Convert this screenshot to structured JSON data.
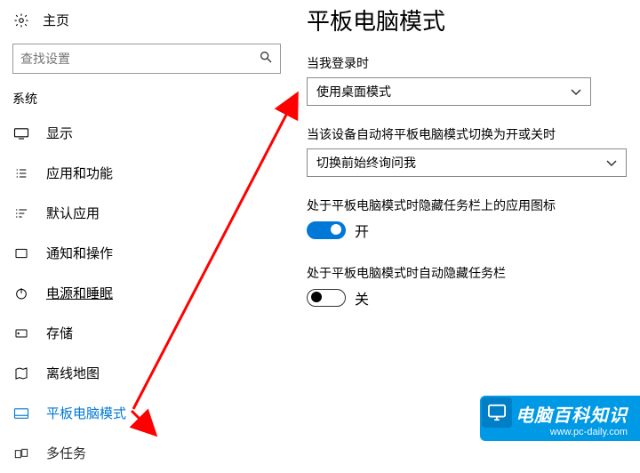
{
  "sidebar": {
    "home_label": "主页",
    "search_placeholder": "查找设置",
    "group_label": "系统",
    "items": [
      {
        "label": "显示"
      },
      {
        "label": "应用和功能"
      },
      {
        "label": "默认应用"
      },
      {
        "label": "通知和操作"
      },
      {
        "label": "电源和睡眠"
      },
      {
        "label": "存储"
      },
      {
        "label": "离线地图"
      },
      {
        "label": "平板电脑模式"
      },
      {
        "label": "多任务"
      }
    ]
  },
  "main": {
    "title": "平板电脑模式",
    "signin_label": "当我登录时",
    "signin_value": "使用桌面模式",
    "autoswitch_label": "当该设备自动将平板电脑模式切换为开或关时",
    "autoswitch_value": "切换前始终询问我",
    "hide_icons_label": "处于平板电脑模式时隐藏任务栏上的应用图标",
    "hide_icons_state": "开",
    "hide_taskbar_label": "处于平板电脑模式时自动隐藏任务栏",
    "hide_taskbar_state": "关"
  },
  "watermark": {
    "title": "电脑百科知识",
    "url": "www.pc-daily.com"
  }
}
